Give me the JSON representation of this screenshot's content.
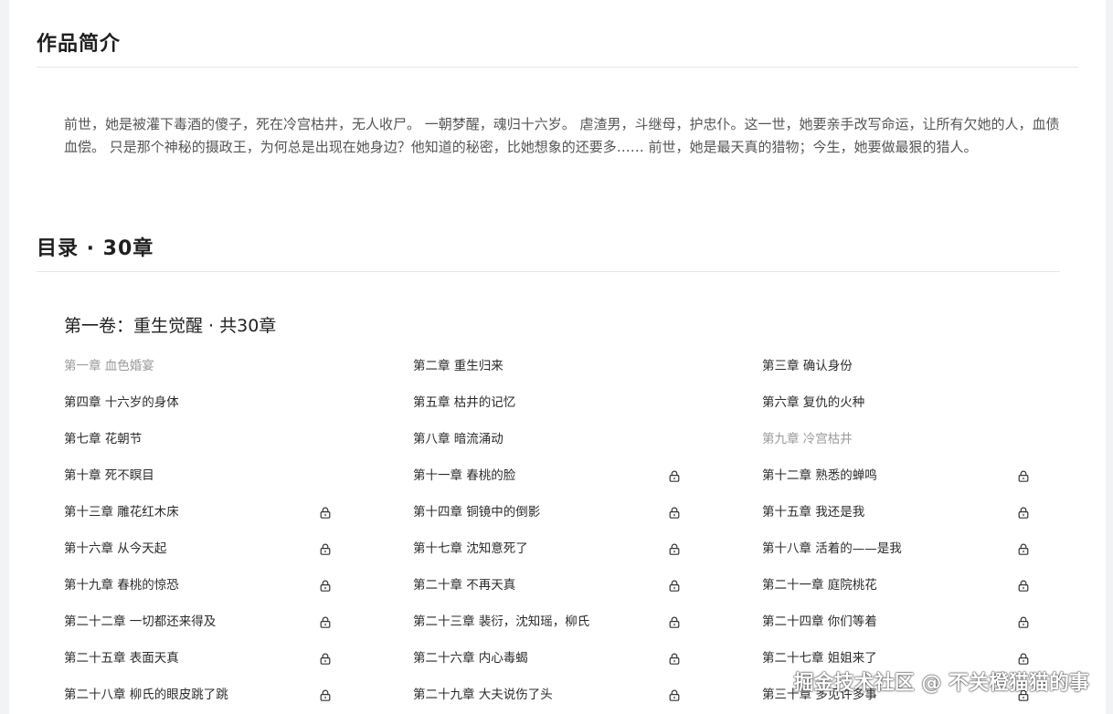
{
  "intro": {
    "title": "作品简介",
    "text": "前世，她是被灌下毒酒的傻子，死在冷宫枯井，无人收尸。 一朝梦醒，魂归十六岁。 虐渣男，斗继母，护忠仆。这一世，她要亲手改写命运，让所有欠她的人，血债血偿。 只是那个神秘的摄政王，为何总是出现在她身边？他知道的秘密，比她想象的还要多…… 前世，她是最天真的猎物；今生，她要做最狠的猎人。"
  },
  "toc": {
    "title": "目录 · 30章",
    "volume_title": "第一卷：重生觉醒 · 共30章",
    "chapters": [
      {
        "label": "第一章 血色婚宴",
        "locked": false,
        "read": true
      },
      {
        "label": "第二章 重生归来",
        "locked": false,
        "read": false
      },
      {
        "label": "第三章 确认身份",
        "locked": false,
        "read": false
      },
      {
        "label": "第四章 十六岁的身体",
        "locked": false,
        "read": false
      },
      {
        "label": "第五章 枯井的记忆",
        "locked": false,
        "read": false
      },
      {
        "label": "第六章 复仇的火种",
        "locked": false,
        "read": false
      },
      {
        "label": "第七章 花朝节",
        "locked": false,
        "read": false
      },
      {
        "label": "第八章 暗流涌动",
        "locked": false,
        "read": false
      },
      {
        "label": "第九章 冷宫枯井",
        "locked": false,
        "read": true
      },
      {
        "label": "第十章 死不瞑目",
        "locked": false,
        "read": false
      },
      {
        "label": "第十一章 春桃的脸",
        "locked": true,
        "read": false
      },
      {
        "label": "第十二章 熟悉的蝉鸣",
        "locked": true,
        "read": false
      },
      {
        "label": "第十三章 雕花红木床",
        "locked": true,
        "read": false
      },
      {
        "label": "第十四章 铜镜中的倒影",
        "locked": true,
        "read": false
      },
      {
        "label": "第十五章 我还是我",
        "locked": true,
        "read": false
      },
      {
        "label": "第十六章 从今天起",
        "locked": true,
        "read": false
      },
      {
        "label": "第十七章 沈知意死了",
        "locked": true,
        "read": false
      },
      {
        "label": "第十八章 活着的——是我",
        "locked": true,
        "read": false
      },
      {
        "label": "第十九章 春桃的惊恐",
        "locked": true,
        "read": false
      },
      {
        "label": "第二十章 不再天真",
        "locked": true,
        "read": false
      },
      {
        "label": "第二十一章 庭院桃花",
        "locked": true,
        "read": false
      },
      {
        "label": "第二十二章 一切都还来得及",
        "locked": true,
        "read": false
      },
      {
        "label": "第二十三章 裴衍，沈知瑶，柳氏",
        "locked": true,
        "read": false
      },
      {
        "label": "第二十四章 你们等着",
        "locked": true,
        "read": false
      },
      {
        "label": "第二十五章 表面天真",
        "locked": true,
        "read": false
      },
      {
        "label": "第二十六章 内心毒蝎",
        "locked": true,
        "read": false
      },
      {
        "label": "第二十七章 姐姐来了",
        "locked": true,
        "read": false
      },
      {
        "label": "第二十八章 柳氏的眼皮跳了跳",
        "locked": true,
        "read": false
      },
      {
        "label": "第二十九章 大夫说伤了头",
        "locked": true,
        "read": false
      },
      {
        "label": "第三十章 多见许多事",
        "locked": true,
        "read": false
      }
    ]
  },
  "watermark": "掘金技术社区 @ 不关橙猫猫的事",
  "colors": {
    "background": "#f2f3f5",
    "card": "#ffffff",
    "divider": "#e6e6e6",
    "text": "#2b2b2b",
    "muted": "#9a9a9a"
  },
  "icons": {
    "lock": "lock-icon"
  }
}
